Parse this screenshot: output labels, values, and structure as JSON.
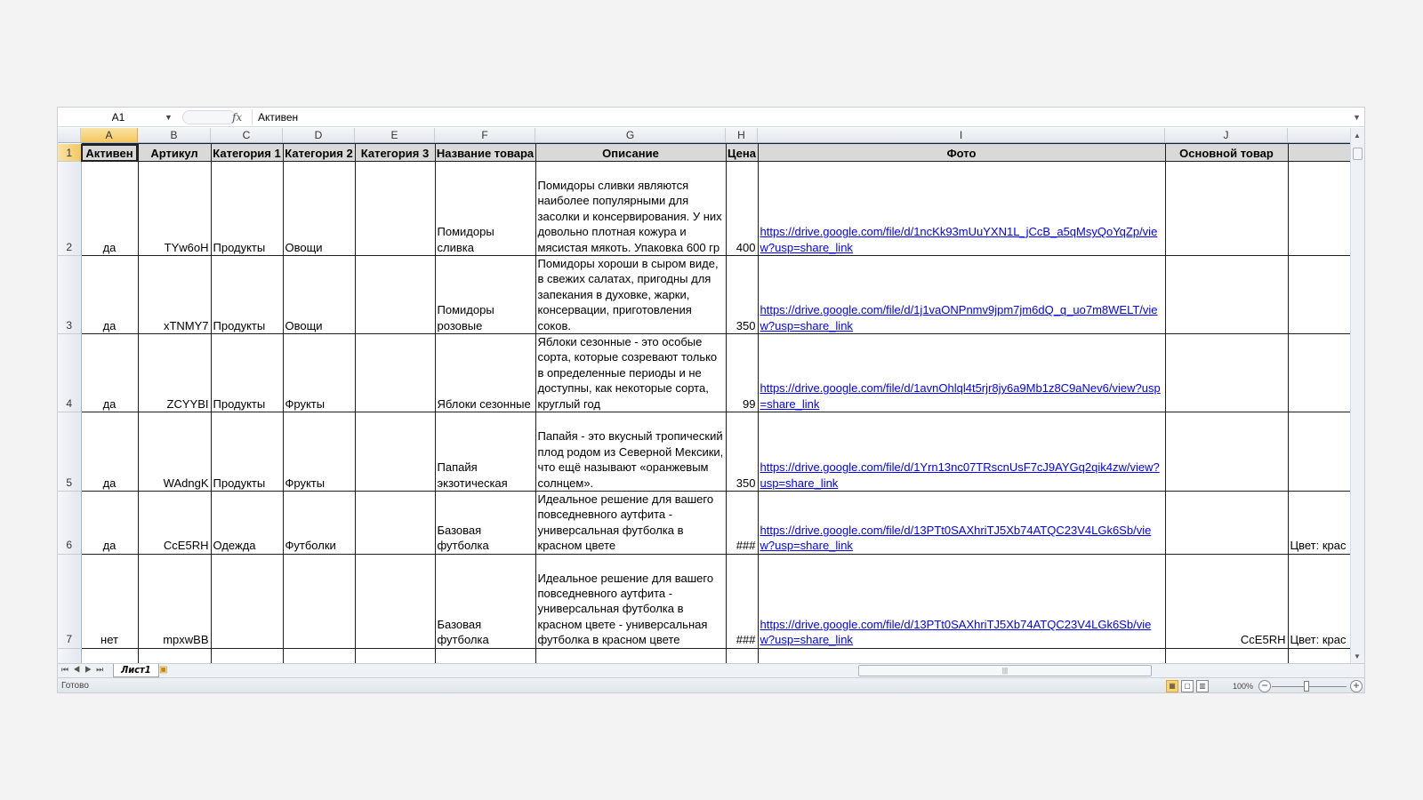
{
  "formula_bar": {
    "name_box": "A1",
    "fx_label": "fx",
    "value": "Активен"
  },
  "columns": [
    "A",
    "B",
    "C",
    "D",
    "E",
    "F",
    "G",
    "H",
    "I",
    "J",
    ""
  ],
  "header_row": {
    "row_number": "1",
    "cells": [
      "Активен",
      "Артикул",
      "Категория 1",
      "Категория 2",
      "Категория 3",
      "Название товара",
      "Описание",
      "Цена",
      "Фото",
      "Основной товар",
      ""
    ]
  },
  "rows": [
    {
      "row_number": "2",
      "cells": [
        "да",
        "TYw6oH",
        "Продукты",
        "Овощи",
        "",
        "Помидоры сливка",
        "Помидоры сливки являются наиболее популярными для засолки и консервирования. У них довольно плотная кожура и мясистая мякоть. Упаковка 600 гр",
        "400",
        "https://drive.google.com/file/d/1ncKk93mUuYXN1L_jCcB_a5qMsyQoYqZp/view?usp=share_link",
        "",
        ""
      ]
    },
    {
      "row_number": "3",
      "cells": [
        "да",
        "xTNMY7",
        "Продукты",
        "Овощи",
        "",
        "Помидоры розовые",
        "Помидоры хороши в сыром виде, в свежих салатах, пригодны для запекания в духовке, жарки, консервации, приготовления соков.",
        "350",
        "https://drive.google.com/file/d/1j1vaONPnmv9jpm7jm6dQ_q_uo7m8WELT/view?usp=share_link",
        "",
        ""
      ]
    },
    {
      "row_number": "4",
      "cells": [
        "да",
        "ZCYYBI",
        "Продукты",
        "Фрукты",
        "",
        "Яблоки сезонные",
        "Яблоки сезонные - это особые сорта, которые созревают только в определенные периоды и не доступны, как некоторые сорта, круглый год",
        "99",
        "https://drive.google.com/file/d/1avnOhlql4t5rjr8jy6a9Mb1z8C9aNev6/view?usp=share_link",
        "",
        ""
      ]
    },
    {
      "row_number": "5",
      "cells": [
        "да",
        "WAdngK",
        "Продукты",
        "Фрукты",
        "",
        "Папайя экзотическая",
        "Папайя - это вкусный тропический плод родом из Северной Мексики, что ещё называют «оранжевым солнцем».",
        "350",
        "https://drive.google.com/file/d/1Yrn13nc07TRscnUsF7cJ9AYGq2qik4zw/view?usp=share_link",
        "",
        ""
      ]
    },
    {
      "row_number": "6",
      "cells": [
        "да",
        "CcE5RH",
        "Одежда",
        "Футболки",
        "",
        "Базовая футболка",
        "Идеальное решение для вашего повседневного аутфита - универсальная футболка в красном цвете",
        "###",
        "https://drive.google.com/file/d/13PTt0SAXhriTJ5Xb74ATQC23V4LGk6Sb/view?usp=share_link",
        "",
        "Цвет: крас"
      ]
    },
    {
      "row_number": "7",
      "cells": [
        "нет",
        "mpxwBB",
        "",
        "",
        "",
        "Базовая футболка",
        "Идеальное решение для вашего повседневного аутфита - универсальная футболка в красном цвете - универсальная футболка в красном цвете",
        "###",
        "https://drive.google.com/file/d/13PTt0SAXhriTJ5Xb74ATQC23V4LGk6Sb/view?usp=share_link",
        "CcE5RH",
        "Цвет: крас"
      ]
    }
  ],
  "sheet_tabs": [
    "Лист1"
  ],
  "status": {
    "ready": "Готово",
    "zoom": "100%"
  },
  "colors": {
    "link": "#0000ff",
    "header_fill": "#d9d9d9",
    "selection": "#f3c75f"
  }
}
